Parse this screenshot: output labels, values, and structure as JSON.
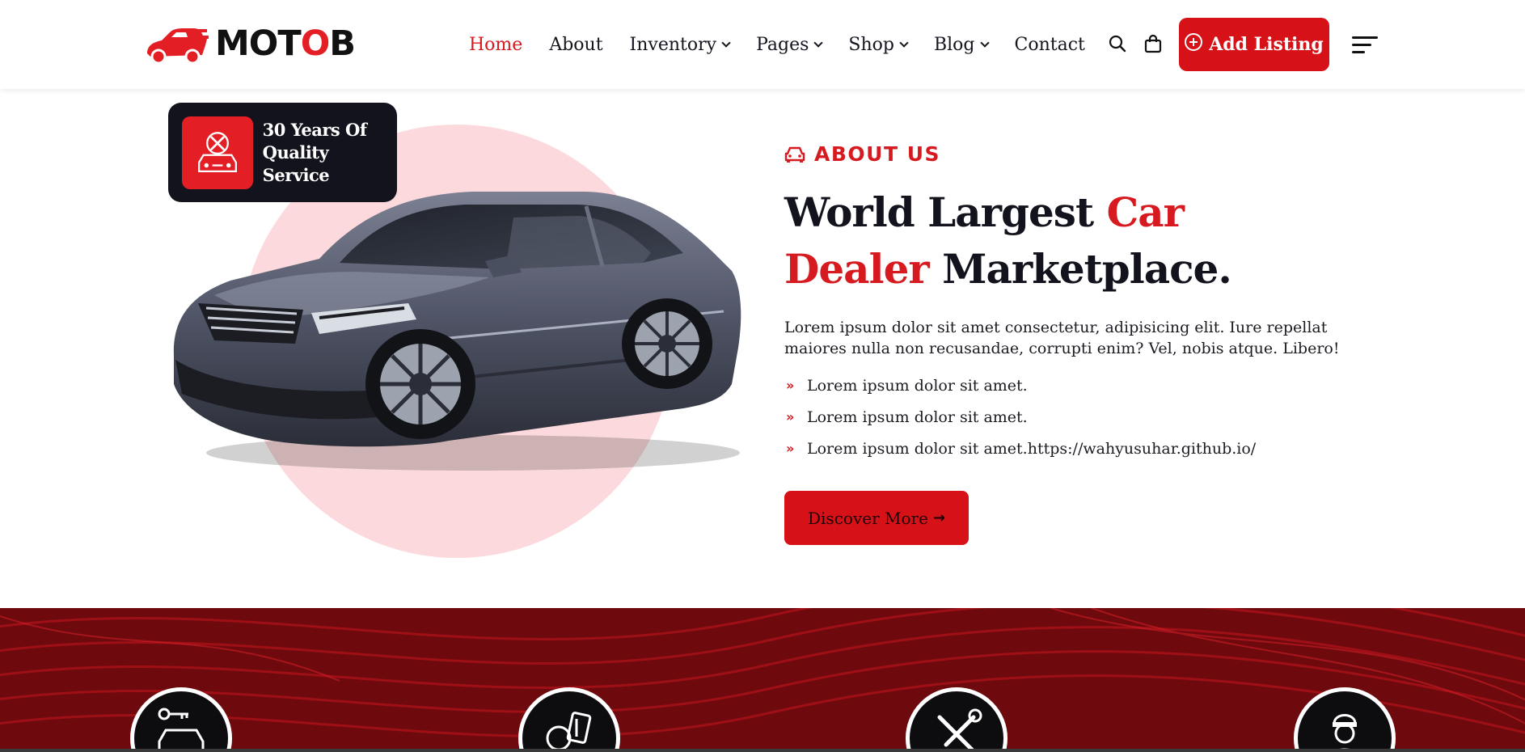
{
  "brand": {
    "logo_text_pre": "MOT",
    "logo_text_o": "O",
    "logo_text_post": "B"
  },
  "nav": {
    "items": [
      {
        "label": "Home",
        "active": true,
        "dropdown": false
      },
      {
        "label": "About",
        "active": false,
        "dropdown": false
      },
      {
        "label": "Inventory",
        "active": false,
        "dropdown": true
      },
      {
        "label": "Pages",
        "active": false,
        "dropdown": true
      },
      {
        "label": "Shop",
        "active": false,
        "dropdown": true
      },
      {
        "label": "Blog",
        "active": false,
        "dropdown": true
      },
      {
        "label": "Contact",
        "active": false,
        "dropdown": false
      }
    ],
    "add_listing_label": "Add Listing",
    "icons": [
      "search-icon",
      "shopping-bag-icon",
      "plus-circle-icon",
      "menu-icon"
    ]
  },
  "about": {
    "badge_line1": "30 Years Of",
    "badge_line2": "Quality Service",
    "eyebrow": "ABOUT US",
    "headline_part1": "World Largest ",
    "headline_red1": "Car",
    "headline_red2": "Dealer",
    "headline_part2": " Marketplace.",
    "paragraph": "Lorem ipsum dolor sit amet consectetur, adipisicing elit. Iure repellat maiores nulla non recusandae, corrupti enim? Vel, nobis atque. Libero!",
    "bullets": [
      "Lorem ipsum dolor sit amet.",
      "Lorem ipsum dolor sit amet.",
      "Lorem ipsum dolor sit amet.https://wahyusuhar.github.io/"
    ],
    "bullet_marker": "»",
    "button_label": "Discover More",
    "button_arrow": "→"
  },
  "services": {
    "icons": [
      "car-key-icon",
      "car-documents-icon",
      "tools-icon",
      "mechanic-icon"
    ]
  },
  "colors": {
    "accent": "#d71920",
    "dark": "#12131c",
    "pink_circle": "#fbd9dc",
    "red_band": "#7a0b10"
  }
}
